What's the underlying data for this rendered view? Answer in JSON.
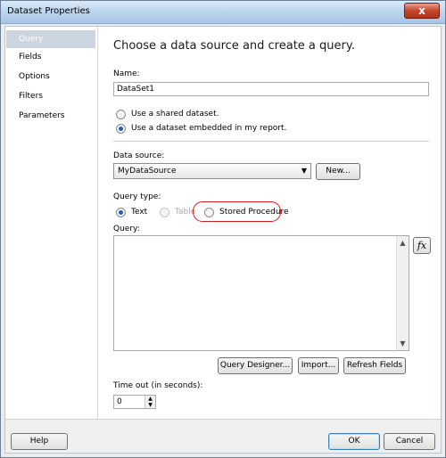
{
  "window": {
    "title": "Dataset Properties",
    "close_label": "x"
  },
  "nav": {
    "items": [
      "Query",
      "Fields",
      "Options",
      "Filters",
      "Parameters"
    ],
    "selected": 0
  },
  "page": {
    "heading": "Choose a data source and create a query."
  },
  "name": {
    "label": "Name:",
    "value": "DataSet1"
  },
  "dataset_source": {
    "options": [
      "Use a shared dataset.",
      "Use a dataset embedded in my report."
    ],
    "selected": 1
  },
  "data_source": {
    "label": "Data source:",
    "value": "MyDataSource",
    "new_button": "New..."
  },
  "query_type": {
    "label": "Query type:",
    "options": [
      "Text",
      "Table",
      "Stored Procedure"
    ],
    "selected": 0,
    "disabled": [
      1
    ]
  },
  "query": {
    "label": "Query:",
    "value": "",
    "fx_label": "fx"
  },
  "buttons": {
    "query_designer": "Query Designer...",
    "import": "Import...",
    "refresh_fields": "Refresh Fields"
  },
  "timeout": {
    "label": "Time out (in seconds):",
    "value": "0"
  },
  "footer": {
    "help": "Help",
    "ok": "OK",
    "cancel": "Cancel"
  },
  "colors": {
    "highlight": "#d31b1b",
    "selection": "#ccd5df"
  }
}
